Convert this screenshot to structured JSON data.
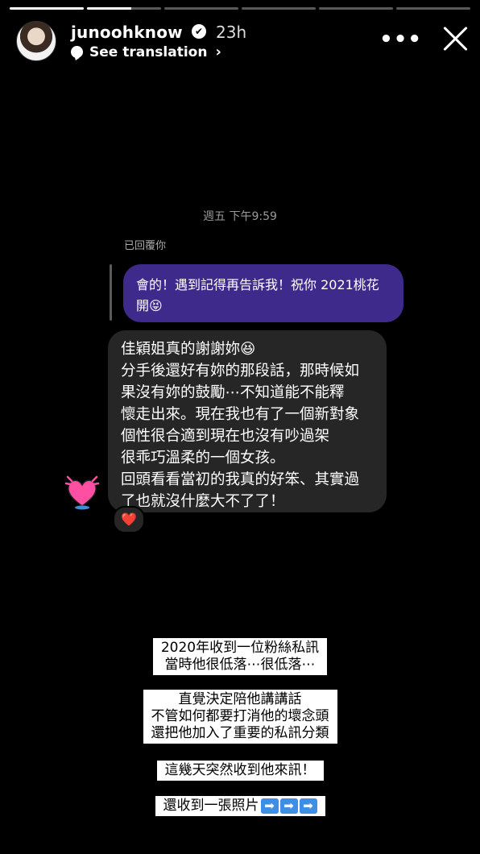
{
  "story": {
    "segments_total": 6,
    "segments_viewed": 1,
    "current_segment_progress": 0.6
  },
  "header": {
    "username": "junoohknow",
    "verified_mark": "✔",
    "time_ago": "23h",
    "see_translation": "See translation",
    "more_label": "•••"
  },
  "chat": {
    "timestamp": "週五 下午9:59",
    "replied_label": "已回覆你",
    "outgoing_lines": [
      "會的！遇到記得再告訴我！祝你 2021桃花",
      "開😝"
    ],
    "incoming_lines": [
      "佳穎姐真的謝謝妳😆",
      "分手後還好有妳的那段話，那時候如",
      "果沒有妳的鼓勵⋯不知道能不能釋",
      "懷走出來。現在我也有了一個新對象",
      "個性很合適到現在也沒有吵過架",
      "很乖巧溫柔的一個女孩。",
      "回頭看看當初的我真的好笨、其實過",
      "了也就沒什麼大不了了！"
    ],
    "reaction": "❤️"
  },
  "captions": {
    "c1_l1": "2020年收到一位粉絲私訊",
    "c1_l2": "當時他很低落⋯很低落⋯",
    "c2_l1": "直覺決定陪他講講話",
    "c2_l2": "不管如何都要打消他的壞念頭",
    "c2_l3": "還把他加入了重要的私訊分類",
    "c3": "這幾天突然收到他來訊！",
    "c4": "還收到一張照片",
    "arrow": "➡"
  },
  "colors": {
    "outgoing_bubble": "#3e2a8a",
    "incoming_bubble": "#262626",
    "sticker": "#ff4fa3"
  }
}
